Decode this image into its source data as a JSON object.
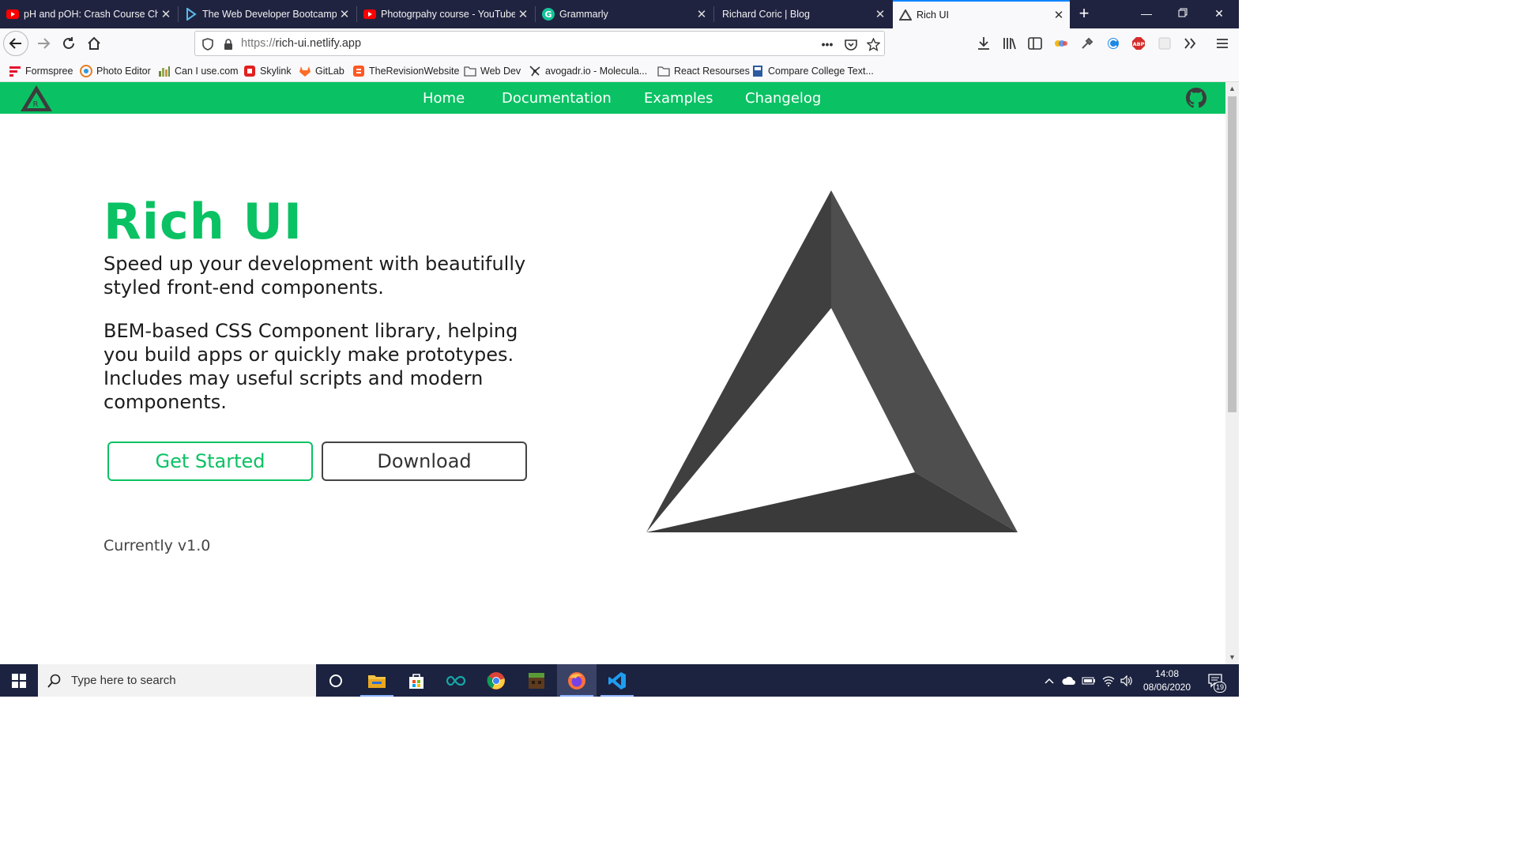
{
  "browser": {
    "tabs": [
      {
        "title": "pH and pOH: Crash Course Ch",
        "favicon": "youtube-icon",
        "active": false
      },
      {
        "title": "The Web Developer Bootcamp",
        "favicon": "udemy-icon",
        "active": false
      },
      {
        "title": "Photogrpahy course - YouTube",
        "favicon": "youtube-icon",
        "active": false
      },
      {
        "title": "Grammarly",
        "favicon": "grammarly-icon",
        "active": false
      },
      {
        "title": "Richard Coric | Blog",
        "favicon": "none",
        "active": false
      },
      {
        "title": "Rich UI",
        "favicon": "rich-ui-icon",
        "active": true
      }
    ],
    "new_tab_label": "+",
    "url_protocol": "https://",
    "url_host": "rich-ui.netlify.app",
    "url_more_label": "•••",
    "bookmarks": [
      {
        "label": "Formspree",
        "icon": "formspree-icon"
      },
      {
        "label": "Photo Editor",
        "icon": "photo-editor-icon"
      },
      {
        "label": "Can I use.com",
        "icon": "caniuse-icon"
      },
      {
        "label": "Skylink",
        "icon": "skylink-icon"
      },
      {
        "label": "GitLab",
        "icon": "gitlab-icon"
      },
      {
        "label": "TheRevisionWebsite",
        "icon": "blogger-icon"
      },
      {
        "label": "Web Dev",
        "icon": "folder-icon"
      },
      {
        "label": "avogadr.io - Molecula...",
        "icon": "molecule-icon"
      },
      {
        "label": "React Resourses",
        "icon": "folder-icon"
      },
      {
        "label": "Compare College Text...",
        "icon": "book-icon"
      }
    ]
  },
  "site": {
    "nav": [
      "Home",
      "Documentation",
      "Examples",
      "Changelog"
    ],
    "title": "Rich UI",
    "subtitle": "Speed up your development with beautifully styled front-end components.",
    "description": "BEM-based CSS Component library, helping you build apps or quickly make prototypes. Includes may useful scripts and modern components.",
    "primary_button": "Get Started",
    "secondary_button": "Download",
    "version": "Currently v1.0",
    "colors": {
      "accent": "#0ac263",
      "nav_text": "#ffffff",
      "body_text": "#1c1c1c",
      "logo_dark": "#444444"
    }
  },
  "taskbar": {
    "search_placeholder": "Type here to search",
    "time": "14:08",
    "date": "08/06/2020",
    "notifications_count": "19",
    "apps": [
      "cortana-icon",
      "file-explorer-icon",
      "store-icon",
      "arduino-icon",
      "chrome-icon",
      "minecraft-icon",
      "firefox-icon",
      "vscode-icon"
    ]
  }
}
